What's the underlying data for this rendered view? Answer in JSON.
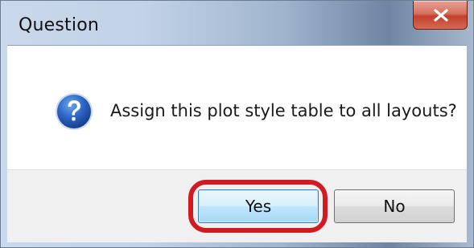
{
  "window": {
    "title": "Question",
    "close_icon": "close-icon"
  },
  "dialog": {
    "icon": "question-icon",
    "message": "Assign this plot style table to all layouts?"
  },
  "buttons": {
    "yes_label": "Yes",
    "no_label": "No"
  },
  "annotation": {
    "highlight_color": "#d11a22"
  }
}
